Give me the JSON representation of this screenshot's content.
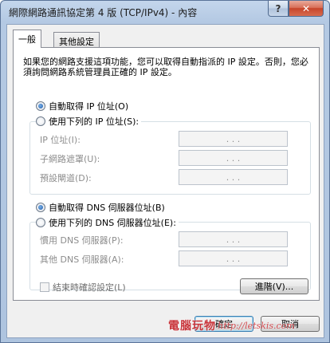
{
  "window": {
    "title": "網際網路通訊協定第 4 版 (TCP/IPv4) - 內容",
    "help_label": "?",
    "close_label": "✕"
  },
  "tabs": [
    {
      "label": "一般",
      "active": true
    },
    {
      "label": "其他設定",
      "active": false
    }
  ],
  "description": "如果您的網路支援這項功能，您可以取得自動指派的 IP 設定。否則，您必須詢問網路系統管理員正確的 IP 設定。",
  "ip": {
    "auto_label": "自動取得 IP 位址(O)",
    "auto_selected": true,
    "manual_label": "使用下列的 IP 位址(S):",
    "fields": [
      {
        "label": "IP 位址(I):",
        "value": ".  .  ."
      },
      {
        "label": "子網路遮罩(U):",
        "value": ".  .  ."
      },
      {
        "label": "預設閘道(D):",
        "value": ".  .  ."
      }
    ]
  },
  "dns": {
    "auto_label": "自動取得 DNS 伺服器位址(B)",
    "auto_selected": true,
    "manual_label": "使用下列的 DNS 伺服器位址(E):",
    "fields": [
      {
        "label": "慣用 DNS 伺服器(P):",
        "value": ".  .  ."
      },
      {
        "label": "其他 DNS 伺服器(A):",
        "value": ".  .  ."
      }
    ]
  },
  "validate_checkbox": {
    "label": "結束時確認設定(L)",
    "checked": false
  },
  "buttons": {
    "advanced": "進階(V)...",
    "ok": "確定",
    "cancel": "取消"
  },
  "watermark": {
    "site": "電腦玩物",
    "url": "http://letskis.com"
  },
  "colors": {
    "accent": "#3c7fb1",
    "close_button": "#c7452a",
    "watermark": "#c8343a"
  }
}
